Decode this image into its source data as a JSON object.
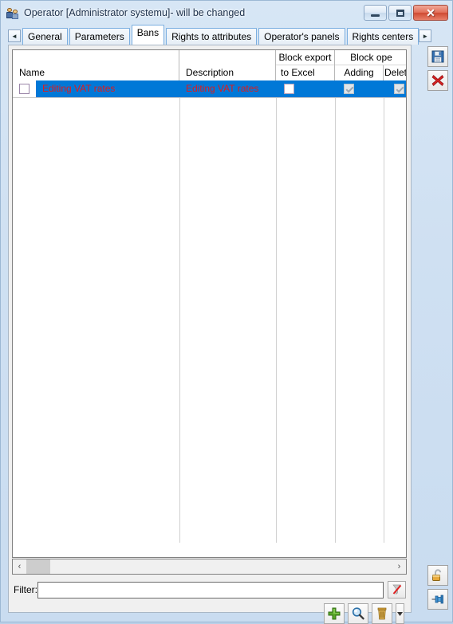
{
  "window": {
    "title": "Operator [Administrator systemu]- will be changed",
    "icon": "operators-icon",
    "minimize_label": "",
    "maximize_label": "",
    "close_label": "✕"
  },
  "tabs": {
    "scroll_left": "◄",
    "scroll_right": "►",
    "items": [
      {
        "label": "General",
        "active": false
      },
      {
        "label": "Parameters",
        "active": false
      },
      {
        "label": "Bans",
        "active": true
      },
      {
        "label": "Rights to attributes",
        "active": false
      },
      {
        "label": "Operator's panels",
        "active": false
      },
      {
        "label": "Rights centers",
        "active": false
      }
    ]
  },
  "grid": {
    "columns": [
      {
        "label": "Name"
      },
      {
        "label": "Description"
      },
      {
        "group": "Block export",
        "sub": [
          "to Excel"
        ]
      },
      {
        "group": "Block ope",
        "sub": [
          "Adding",
          "Delet"
        ]
      }
    ],
    "rows": [
      {
        "selected": true,
        "row_checkbox": "unchecked",
        "name": "Editing VAT rates",
        "description": "Editing VAT rates",
        "block_export_to_excel": "unchecked",
        "block_adding": "checked-disabled",
        "block_deleting": "checked-disabled"
      }
    ],
    "scrollbar": {
      "left_arrow": "‹",
      "right_arrow": "›"
    }
  },
  "filter": {
    "label": "Filter:",
    "value": "",
    "placeholder": "",
    "clear_icon": "clear-filter-icon"
  },
  "actions": [
    {
      "name": "add-button",
      "icon": "plus-icon"
    },
    {
      "name": "search-button",
      "icon": "magnifier-icon"
    },
    {
      "name": "delete-button",
      "icon": "trash-icon"
    },
    {
      "name": "more-button",
      "icon": "chevron-down-icon"
    }
  ],
  "side_buttons_top": [
    {
      "name": "save-button",
      "icon": "floppy-disk-icon"
    },
    {
      "name": "cancel-button",
      "icon": "red-x-icon"
    }
  ],
  "side_buttons_bottom": [
    {
      "name": "unlock-button",
      "icon": "open-padlock-icon"
    },
    {
      "name": "pin-button",
      "icon": "pin-icon"
    }
  ],
  "colors": {
    "selection": "#0078d7",
    "row_text": "#e01b1b",
    "window_frame": "#cfe0f2",
    "tab_border": "#7aaee0",
    "close_button": "#cf4a32"
  }
}
